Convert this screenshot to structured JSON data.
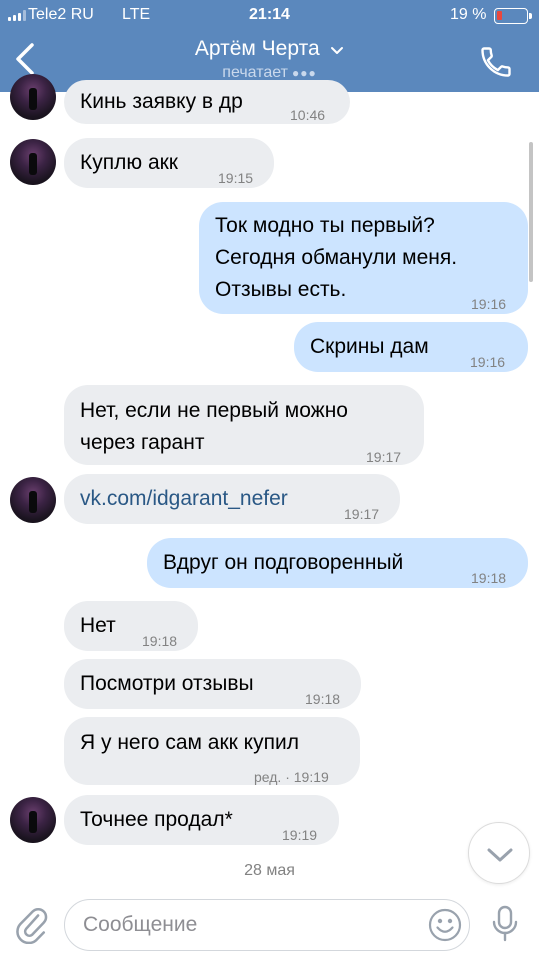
{
  "status_bar": {
    "carrier": "Tele2 RU",
    "network": "LTE",
    "time": "21:14",
    "battery_percent": "19 %",
    "battery_level": 0.19
  },
  "header": {
    "title": "Артём Черта",
    "status": "печатает",
    "back_icon": "chevron-left-icon",
    "call_icon": "phone-icon",
    "color": "#5b88bd"
  },
  "messages": [
    {
      "dir": "in",
      "text": "Кинь заявку в др",
      "time": "10:46"
    },
    {
      "dir": "in",
      "text": "Куплю акк",
      "time": "19:15"
    },
    {
      "dir": "out",
      "lines": [
        "Ток модно ты первый?",
        "Сегодня обманули меня.",
        "Отзывы есть."
      ],
      "time": "19:16"
    },
    {
      "dir": "out",
      "text": "Скрины дам",
      "time": "19:16"
    },
    {
      "dir": "in",
      "lines": [
        "Нет, если не первый можно",
        "через гарант"
      ],
      "time": "19:17"
    },
    {
      "dir": "in",
      "text": "vk.com/idgarant_nefer",
      "time": "19:17"
    },
    {
      "dir": "out",
      "text": "Вдруг он подговоренный",
      "time": "19:18"
    },
    {
      "dir": "in",
      "text": "Нет",
      "time": "19:18"
    },
    {
      "dir": "in",
      "text": "Посмотри отзывы",
      "time": "19:18"
    },
    {
      "dir": "in",
      "text": "Я у него сам акк купил",
      "time": "ред. · 19:19"
    },
    {
      "dir": "in",
      "text": "Точнее продал*",
      "time": "19:19"
    }
  ],
  "date_separator": "28 мая",
  "composer": {
    "placeholder": "Сообщение",
    "attach_icon": "paperclip-icon",
    "emoji_icon": "emoji-icon",
    "mic_icon": "microphone-icon"
  },
  "colors": {
    "incoming_bubble": "#ebedf0",
    "outgoing_bubble": "#cce4ff",
    "link": "#2a5885"
  }
}
